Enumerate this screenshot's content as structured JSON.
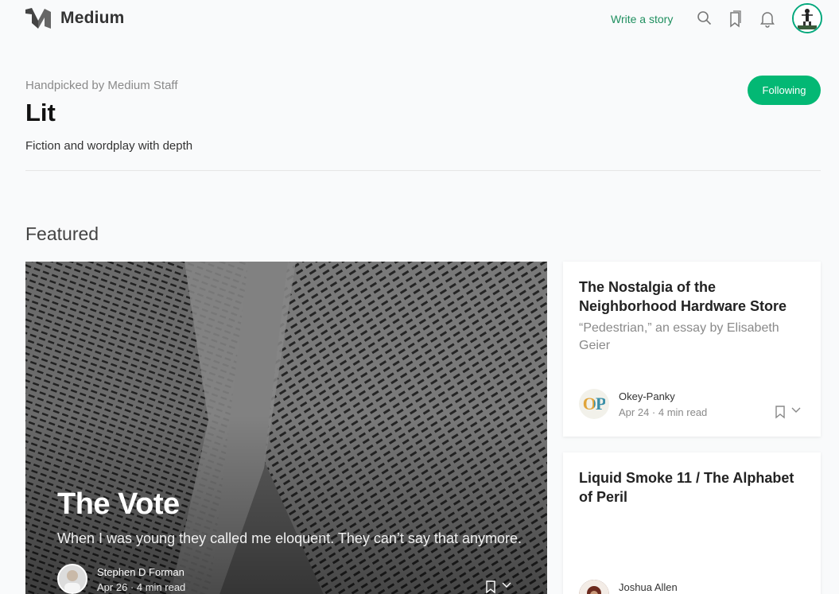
{
  "header": {
    "logo_text": "Medium",
    "write_label": "Write a story",
    "icons": [
      "search-icon",
      "bookmarks-icon",
      "bell-icon"
    ]
  },
  "topic": {
    "kicker": "Handpicked by Medium Staff",
    "title": "Lit",
    "description": "Fiction and wordplay with depth",
    "follow_label": "Following"
  },
  "section": {
    "title": "Featured"
  },
  "featured": {
    "title": "The Vote",
    "subtitle": "When I was young they called me eloquent. They can’t say that anymore.",
    "author": "Stephen D Forman",
    "meta": "Apr 26 · 4 min read"
  },
  "cards": [
    {
      "title": "The Nostalgia of the Neighborhood Hardware Store",
      "subtitle": "“Pedestrian,” an essay by Elisabeth Geier",
      "author": "Okey-Panky",
      "avatar_text": "OP",
      "meta": "Apr 24 · 4 min read"
    },
    {
      "title": "Liquid Smoke 11 / The Alphabet of Peril",
      "author": "Joshua Allen"
    }
  ],
  "colors": {
    "accent": "#03b874",
    "link": "#1f8f5f"
  }
}
